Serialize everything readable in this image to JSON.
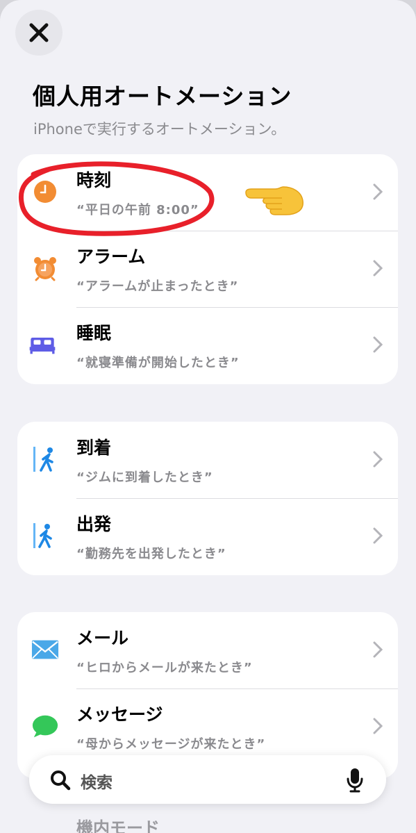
{
  "header": {
    "title": "個人用オートメーション",
    "subtitle": "iPhoneで実行するオートメーション。"
  },
  "groups": [
    {
      "items": [
        {
          "title": "時刻",
          "subtitle": "“平日の午前 8:00”",
          "icon": "clock-icon"
        },
        {
          "title": "アラーム",
          "subtitle": "“アラームが止まったとき”",
          "icon": "alarm-clock-icon"
        },
        {
          "title": "睡眠",
          "subtitle": "“就寝準備が開始したとき”",
          "icon": "bed-icon"
        }
      ]
    },
    {
      "items": [
        {
          "title": "到着",
          "subtitle": "“ジムに到着したとき”",
          "icon": "walk-arrive-icon"
        },
        {
          "title": "出発",
          "subtitle": "“勤務先を出発したとき”",
          "icon": "walk-leave-icon"
        }
      ]
    },
    {
      "items": [
        {
          "title": "メール",
          "subtitle": "“ヒロからメールが来たとき”",
          "icon": "mail-icon"
        },
        {
          "title": "メッセージ",
          "subtitle": "“母からメッセージが来たとき”",
          "icon": "message-icon"
        }
      ]
    }
  ],
  "peek_item": {
    "title": "機内モード"
  },
  "search": {
    "placeholder": "検索"
  },
  "colors": {
    "orange": "#f28c33",
    "purple": "#5e5ce6",
    "blue": "#1e88e5",
    "green": "#34c759",
    "annotation_red": "#e8202a"
  }
}
